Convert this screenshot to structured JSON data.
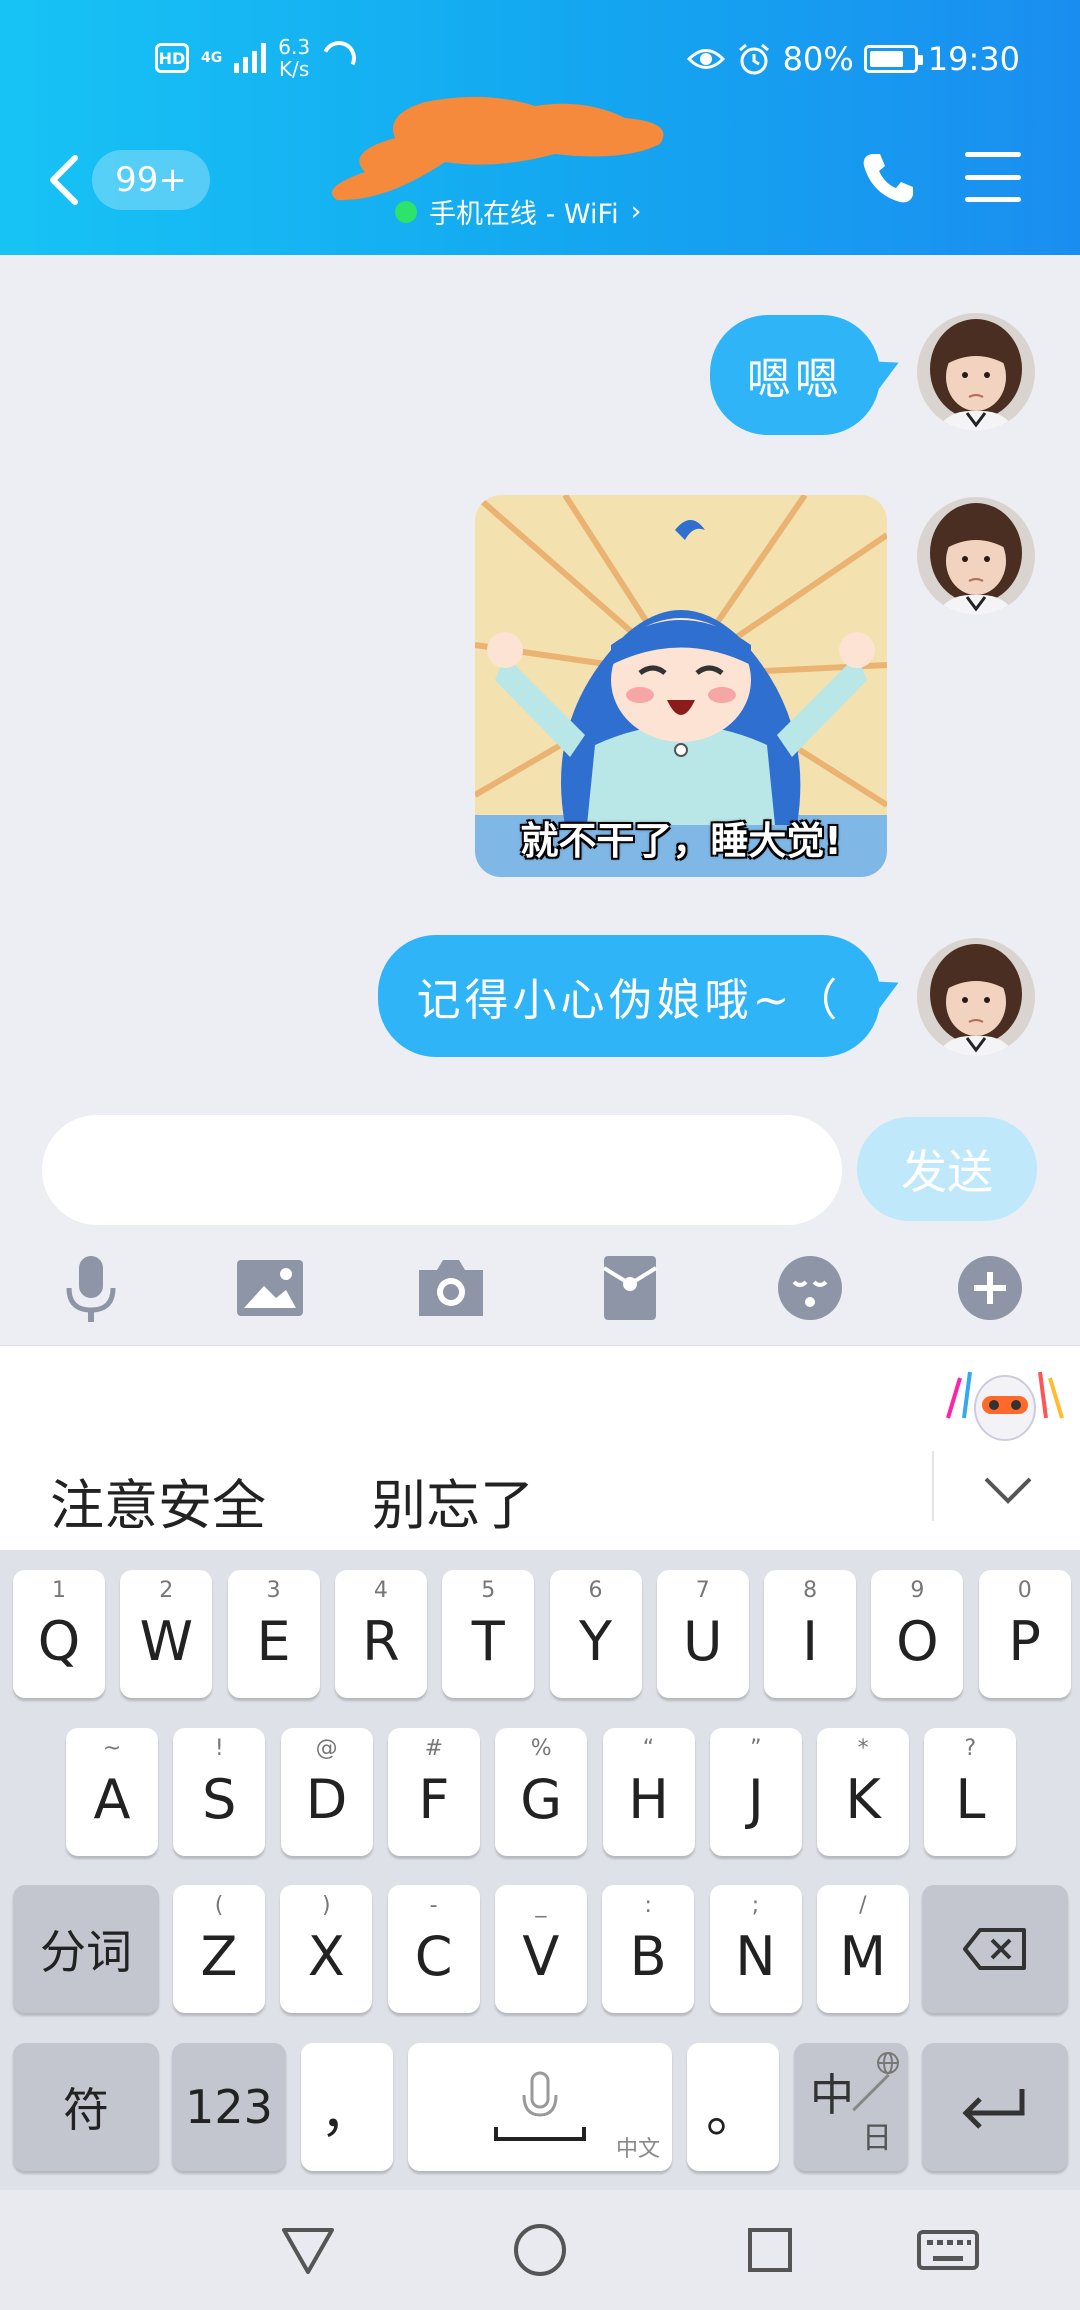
{
  "status_bar": {
    "hd": "HD",
    "net_type": "4G",
    "speed_value": "6.3",
    "speed_unit": "K/s",
    "battery": "80%",
    "time": "19:30",
    "battery_level": 0.8
  },
  "header": {
    "unread_count": "99+",
    "online_status": "手机在线 - WiFi",
    "online_chevron": "›"
  },
  "messages": [
    {
      "type": "text",
      "sender": "me",
      "text": "嗯嗯"
    },
    {
      "type": "sticker",
      "sender": "me",
      "caption": "就不干了，睡大觉!"
    },
    {
      "type": "text",
      "sender": "me",
      "text": "记得小心伪娘哦~（"
    }
  ],
  "input": {
    "value": "",
    "send_label": "发送"
  },
  "toolbar": {
    "icons": [
      "microphone-icon",
      "image-icon",
      "camera-icon",
      "red-packet-icon",
      "emoji-icon",
      "plus-icon"
    ]
  },
  "suggestions": {
    "items": [
      "注意安全",
      "别忘了"
    ]
  },
  "keyboard": {
    "row1": [
      {
        "key": "Q",
        "sub": "1"
      },
      {
        "key": "W",
        "sub": "2"
      },
      {
        "key": "E",
        "sub": "3"
      },
      {
        "key": "R",
        "sub": "4"
      },
      {
        "key": "T",
        "sub": "5"
      },
      {
        "key": "Y",
        "sub": "6"
      },
      {
        "key": "U",
        "sub": "7"
      },
      {
        "key": "I",
        "sub": "8"
      },
      {
        "key": "O",
        "sub": "9"
      },
      {
        "key": "P",
        "sub": "0"
      }
    ],
    "row2": [
      {
        "key": "A",
        "sub": "~"
      },
      {
        "key": "S",
        "sub": "!"
      },
      {
        "key": "D",
        "sub": "@"
      },
      {
        "key": "F",
        "sub": "#"
      },
      {
        "key": "G",
        "sub": "%"
      },
      {
        "key": "H",
        "sub": "“"
      },
      {
        "key": "J",
        "sub": "”"
      },
      {
        "key": "K",
        "sub": "*"
      },
      {
        "key": "L",
        "sub": "?"
      }
    ],
    "row3": [
      {
        "key": "Z",
        "sub": "("
      },
      {
        "key": "X",
        "sub": ")"
      },
      {
        "key": "C",
        "sub": "-"
      },
      {
        "key": "V",
        "sub": "_"
      },
      {
        "key": "B",
        "sub": ":"
      },
      {
        "key": "N",
        "sub": ";"
      },
      {
        "key": "M",
        "sub": "/"
      }
    ],
    "segment_label": "分词",
    "symbols_label": "符",
    "numbers_label": "123",
    "comma_label": "，",
    "space_hint": "中文",
    "period_label": "。",
    "lang_main": "中",
    "lang_alt": "日"
  }
}
